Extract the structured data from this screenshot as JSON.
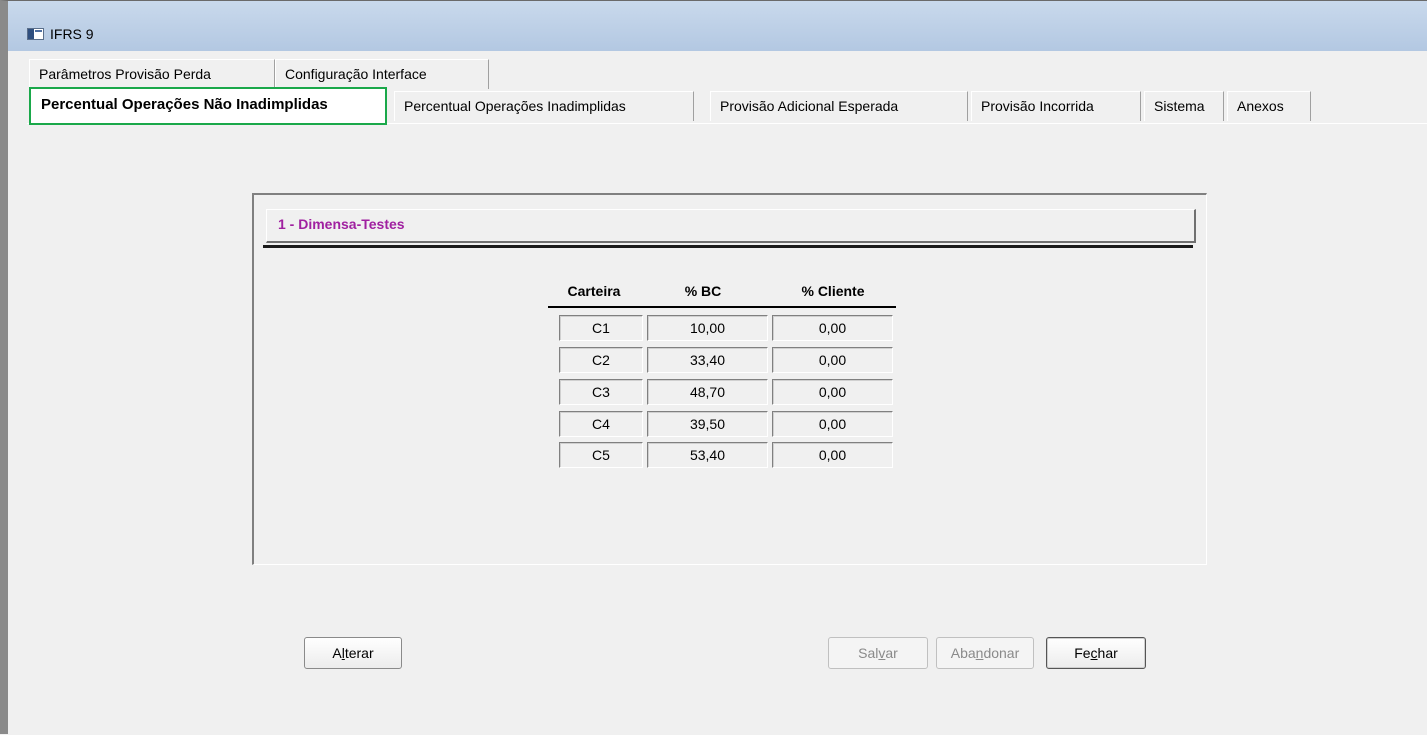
{
  "window": {
    "title": "IFRS 9"
  },
  "tabs_row1": [
    {
      "label": "Parâmetros Provisão Perda"
    },
    {
      "label": "Configuração Interface"
    }
  ],
  "tabs_row2": [
    {
      "label": "Percentual Operações Não Inadimplidas",
      "active": true
    },
    {
      "label": "Percentual Operações Inadimplidas"
    },
    {
      "label": "Provisão Adicional Esperada"
    },
    {
      "label": "Provisão Incorrida"
    },
    {
      "label": "Sistema"
    },
    {
      "label": "Anexos"
    }
  ],
  "group": {
    "title": "1 - Dimensa-Testes",
    "title_color": "#a020a0"
  },
  "table": {
    "headers": [
      "Carteira",
      "% BC",
      "% Cliente"
    ],
    "rows": [
      [
        "C1",
        "10,00",
        "0,00"
      ],
      [
        "C2",
        "33,40",
        "0,00"
      ],
      [
        "C3",
        "48,70",
        "0,00"
      ],
      [
        "C4",
        "39,50",
        "0,00"
      ],
      [
        "C5",
        "53,40",
        "0,00"
      ]
    ]
  },
  "buttons": {
    "alterar": {
      "pre": "A",
      "ul": "l",
      "post": "terar"
    },
    "salvar": {
      "pre": "Sal",
      "ul": "v",
      "post": "ar",
      "disabled": true
    },
    "abandonar": {
      "pre": "Aba",
      "ul": "n",
      "post": "donar",
      "disabled": true
    },
    "fechar": {
      "pre": "Fe",
      "ul": "c",
      "post": "har"
    }
  },
  "colors": {
    "active_tab_highlight": "#1aa84a"
  }
}
